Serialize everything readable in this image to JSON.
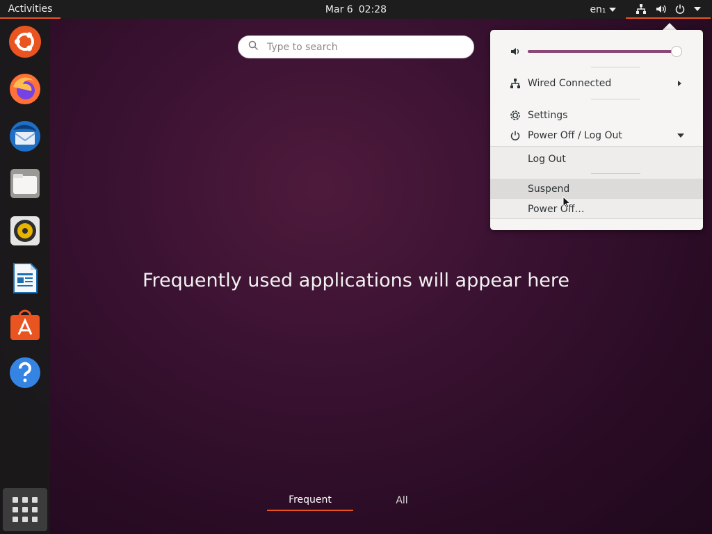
{
  "topbar": {
    "activities_label": "Activities",
    "date": "Mar 6",
    "time": "02:28",
    "language": "en₁",
    "accent_color": "#e95420"
  },
  "dock": {
    "items": [
      {
        "name": "ubuntu-icon"
      },
      {
        "name": "firefox-icon"
      },
      {
        "name": "thunderbird-icon"
      },
      {
        "name": "files-icon"
      },
      {
        "name": "rhythmbox-icon"
      },
      {
        "name": "libreoffice-writer-icon"
      },
      {
        "name": "ubuntu-software-icon"
      },
      {
        "name": "help-icon"
      }
    ],
    "show_apps_icon": "app-grid-icon"
  },
  "search": {
    "placeholder": "Type to search"
  },
  "overview": {
    "empty_message": "Frequently used applications will appear here"
  },
  "tabs": {
    "frequent": "Frequent",
    "all": "All"
  },
  "system_menu": {
    "volume_level": 1.0,
    "items": [
      {
        "label": "Wired Connected",
        "icon": "network-icon"
      },
      {
        "label": "Settings",
        "icon": "settings-icon"
      },
      {
        "label": "Power Off / Log Out",
        "icon": "power-icon"
      }
    ],
    "submenu": [
      {
        "label": "Log Out"
      },
      {
        "label": "Suspend"
      },
      {
        "label": "Power Off…"
      }
    ]
  }
}
